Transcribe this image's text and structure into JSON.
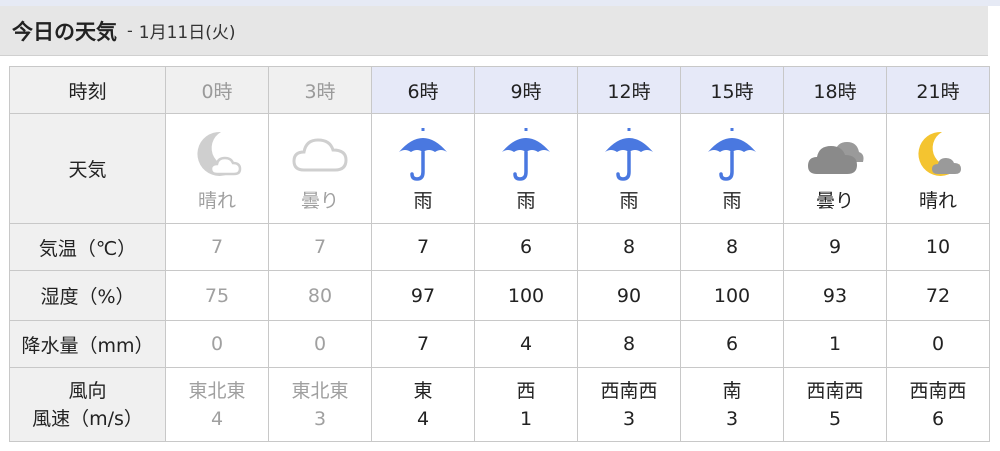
{
  "header": {
    "title": "今日の天気",
    "separator": "-",
    "date": "1月11日(火)"
  },
  "labels": {
    "time": "時刻",
    "weather": "天気",
    "temp": "気温（℃）",
    "humidity": "湿度（%）",
    "precip": "降水量（mm）",
    "wind_dir": "風向",
    "wind_speed": "風速（m/s）"
  },
  "hours": [
    {
      "time": "0時",
      "past": true,
      "icon": "night-partly-cloudy-icon",
      "weather": "晴れ",
      "temp": "7",
      "humidity": "75",
      "precip": "0",
      "wind_dir": "東北東",
      "wind_speed": "4"
    },
    {
      "time": "3時",
      "past": true,
      "icon": "cloud-icon",
      "weather": "曇り",
      "temp": "7",
      "humidity": "80",
      "precip": "0",
      "wind_dir": "東北東",
      "wind_speed": "3"
    },
    {
      "time": "6時",
      "past": false,
      "icon": "umbrella-icon",
      "weather": "雨",
      "temp": "7",
      "humidity": "97",
      "precip": "7",
      "wind_dir": "東",
      "wind_speed": "4"
    },
    {
      "time": "9時",
      "past": false,
      "icon": "umbrella-icon",
      "weather": "雨",
      "temp": "6",
      "humidity": "100",
      "precip": "4",
      "wind_dir": "西",
      "wind_speed": "1"
    },
    {
      "time": "12時",
      "past": false,
      "icon": "umbrella-icon",
      "weather": "雨",
      "temp": "8",
      "humidity": "90",
      "precip": "8",
      "wind_dir": "西南西",
      "wind_speed": "3"
    },
    {
      "time": "15時",
      "past": false,
      "icon": "umbrella-icon",
      "weather": "雨",
      "temp": "8",
      "humidity": "100",
      "precip": "6",
      "wind_dir": "南",
      "wind_speed": "3"
    },
    {
      "time": "18時",
      "past": false,
      "icon": "cloudy-icon",
      "weather": "曇り",
      "temp": "9",
      "humidity": "93",
      "precip": "1",
      "wind_dir": "西南西",
      "wind_speed": "5"
    },
    {
      "time": "21時",
      "past": false,
      "icon": "night-partly-cloudy-icon",
      "weather": "晴れ",
      "temp": "10",
      "humidity": "72",
      "precip": "0",
      "wind_dir": "西南西",
      "wind_speed": "6"
    }
  ],
  "colors": {
    "rain_blue": "#4a78e0",
    "moon_yellow": "#f4c430",
    "cloud_gray": "#8a8a8a",
    "past_gray": "#cfcfcf",
    "future_header_bg": "#e6e9f8",
    "label_bg": "#f0f0f0"
  }
}
